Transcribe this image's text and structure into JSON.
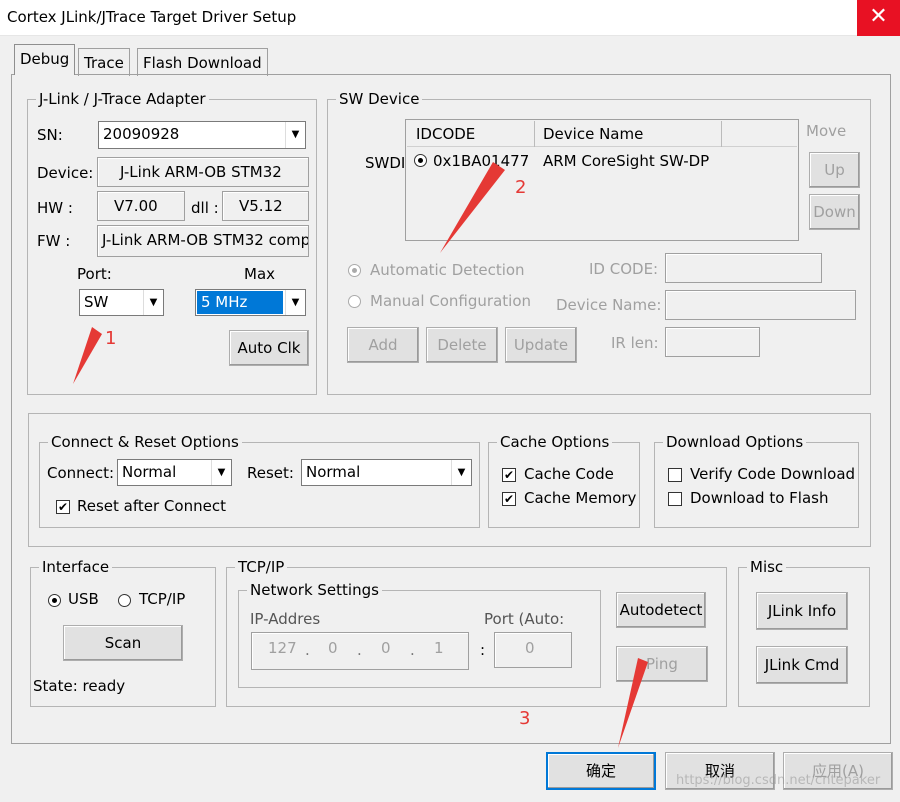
{
  "window": {
    "title": "Cortex JLink/JTrace Target Driver Setup",
    "close_glyph": "✕"
  },
  "tabs": [
    {
      "label": "Debug"
    },
    {
      "label": "Trace"
    },
    {
      "label": "Flash Download"
    }
  ],
  "adapter": {
    "group_label": "J-Link / J-Trace Adapter",
    "sn_label": "SN:",
    "sn_value": "20090928",
    "device_label": "Device:",
    "device_value": "J-Link ARM-OB STM32",
    "hw_label": "HW :",
    "hw_value": "V7.00",
    "dll_label": "dll :",
    "dll_value": "V5.12",
    "fw_label": "FW :",
    "fw_value": "J-Link ARM-OB STM32 comp",
    "port_label": "Port:",
    "port_value": "SW",
    "max_label": "Max",
    "max_value": "5 MHz",
    "auto_clk": "Auto Clk"
  },
  "sw_device": {
    "group_label": "SW Device",
    "swdi_label": "SWDI",
    "col_idcode": "IDCODE",
    "col_device_name": "Device Name",
    "row_idcode": "0x1BA01477",
    "row_device_name": "ARM CoreSight SW-DP",
    "move_label": "Move",
    "up": "Up",
    "down": "Down",
    "auto_detect": "Automatic Detection",
    "manual_config": "Manual Configuration",
    "id_code_label": "ID CODE:",
    "device_name_label": "Device Name:",
    "ir_len_label": "IR len:",
    "add": "Add",
    "delete": "Delete",
    "update": "Update"
  },
  "connect_reset": {
    "group_label": "Connect & Reset Options",
    "connect_label": "Connect:",
    "connect_value": "Normal",
    "reset_label": "Reset:",
    "reset_value": "Normal",
    "reset_after_connect": "Reset after Connect"
  },
  "cache": {
    "group_label": "Cache Options",
    "cache_code": "Cache Code",
    "cache_memory": "Cache Memory"
  },
  "download": {
    "group_label": "Download Options",
    "verify": "Verify Code Download",
    "to_flash": "Download to Flash"
  },
  "interface": {
    "group_label": "Interface",
    "usb": "USB",
    "tcpip": "TCP/IP",
    "scan": "Scan",
    "state": "State: ready"
  },
  "tcpip": {
    "group_label": "TCP/IP",
    "network_label": "Network Settings",
    "ip_label": "IP-Addres",
    "port_label": "Port (Auto:",
    "ip": [
      "127",
      "0",
      "0",
      "1"
    ],
    "port_value": "0",
    "autodetect": "Autodetect",
    "ping": "Ping"
  },
  "misc": {
    "group_label": "Misc",
    "jlink_info": "JLink Info",
    "jlink_cmd": "JLink Cmd"
  },
  "footer": {
    "ok": "确定",
    "cancel": "取消",
    "apply": "应用(A)",
    "watermark": "https://blog.csdn.net/cntepaker"
  },
  "annotations": {
    "n1": "1",
    "n2": "2",
    "n3": "3"
  },
  "colors": {
    "close_red": "#e81123",
    "selection_blue": "#0078d7",
    "annotation_red": "#e53935"
  }
}
